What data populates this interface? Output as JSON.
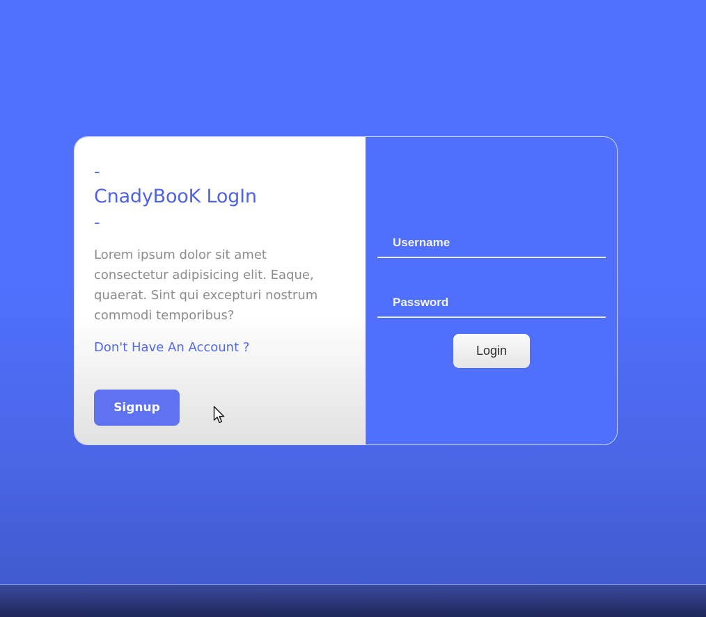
{
  "colors": {
    "background": "#5070fe",
    "accent": "#4e63e8",
    "signup_button": "#5f73f0",
    "right_panel": "#506ffc",
    "muted_text": "#8c8c8c"
  },
  "left": {
    "dash_top": "-",
    "title": "CnadyBooK LogIn",
    "dash_bottom": "-",
    "description": "Lorem ipsum dolor sit amet consectetur adipisicing elit. Eaque, quaerat. Sint qui excepturi nostrum commodi temporibus?",
    "no_account_text": "Don't Have An Account ?",
    "signup_label": "Signup"
  },
  "right": {
    "username_placeholder": "Username",
    "password_placeholder": "Password",
    "login_label": "Login"
  },
  "icons": {
    "cursor": "mouse-pointer-icon"
  }
}
